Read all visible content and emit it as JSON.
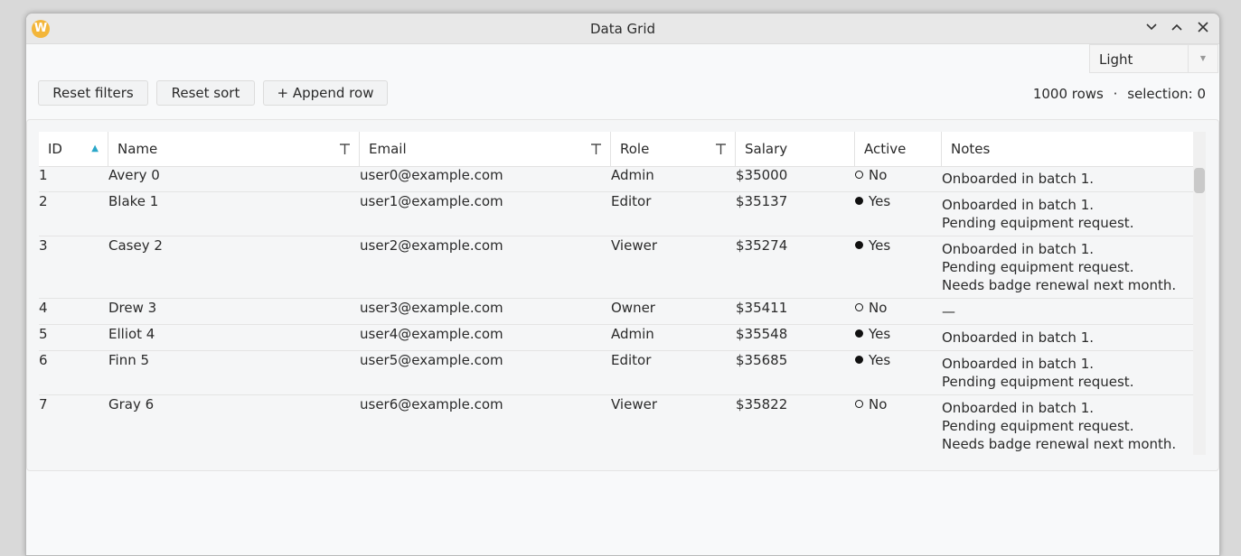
{
  "window": {
    "title": "Data Grid"
  },
  "theme": {
    "selected": "Light"
  },
  "toolbar": {
    "reset_filters": "Reset filters",
    "reset_sort": "Reset sort",
    "append_row": "+ Append row"
  },
  "status": {
    "rows": "1000 rows",
    "separator": "·",
    "selection": "selection: 0"
  },
  "columns": [
    "ID",
    "Name",
    "Email",
    "Role",
    "Salary",
    "Active",
    "Notes"
  ],
  "rows": [
    {
      "id": "1",
      "name": "Avery 0",
      "email": "user0@example.com",
      "role": "Admin",
      "salary": "$35000",
      "active": "No",
      "notes": [
        "Onboarded in batch 1."
      ]
    },
    {
      "id": "2",
      "name": "Blake 1",
      "email": "user1@example.com",
      "role": "Editor",
      "salary": "$35137",
      "active": "Yes",
      "notes": [
        "Onboarded in batch 1.",
        "Pending equipment request."
      ]
    },
    {
      "id": "3",
      "name": "Casey 2",
      "email": "user2@example.com",
      "role": "Viewer",
      "salary": "$35274",
      "active": "Yes",
      "notes": [
        "Onboarded in batch 1.",
        "Pending equipment request.",
        "Needs badge renewal next month."
      ]
    },
    {
      "id": "4",
      "name": "Drew 3",
      "email": "user3@example.com",
      "role": "Owner",
      "salary": "$35411",
      "active": "No",
      "notes": [
        "—"
      ]
    },
    {
      "id": "5",
      "name": "Elliot 4",
      "email": "user4@example.com",
      "role": "Admin",
      "salary": "$35548",
      "active": "Yes",
      "notes": [
        "Onboarded in batch 1."
      ]
    },
    {
      "id": "6",
      "name": "Finn 5",
      "email": "user5@example.com",
      "role": "Editor",
      "salary": "$35685",
      "active": "Yes",
      "notes": [
        "Onboarded in batch 1.",
        "Pending equipment request."
      ]
    },
    {
      "id": "7",
      "name": "Gray 6",
      "email": "user6@example.com",
      "role": "Viewer",
      "salary": "$35822",
      "active": "No",
      "notes": [
        "Onboarded in batch 1.",
        "Pending equipment request.",
        "Needs badge renewal next month."
      ]
    }
  ]
}
